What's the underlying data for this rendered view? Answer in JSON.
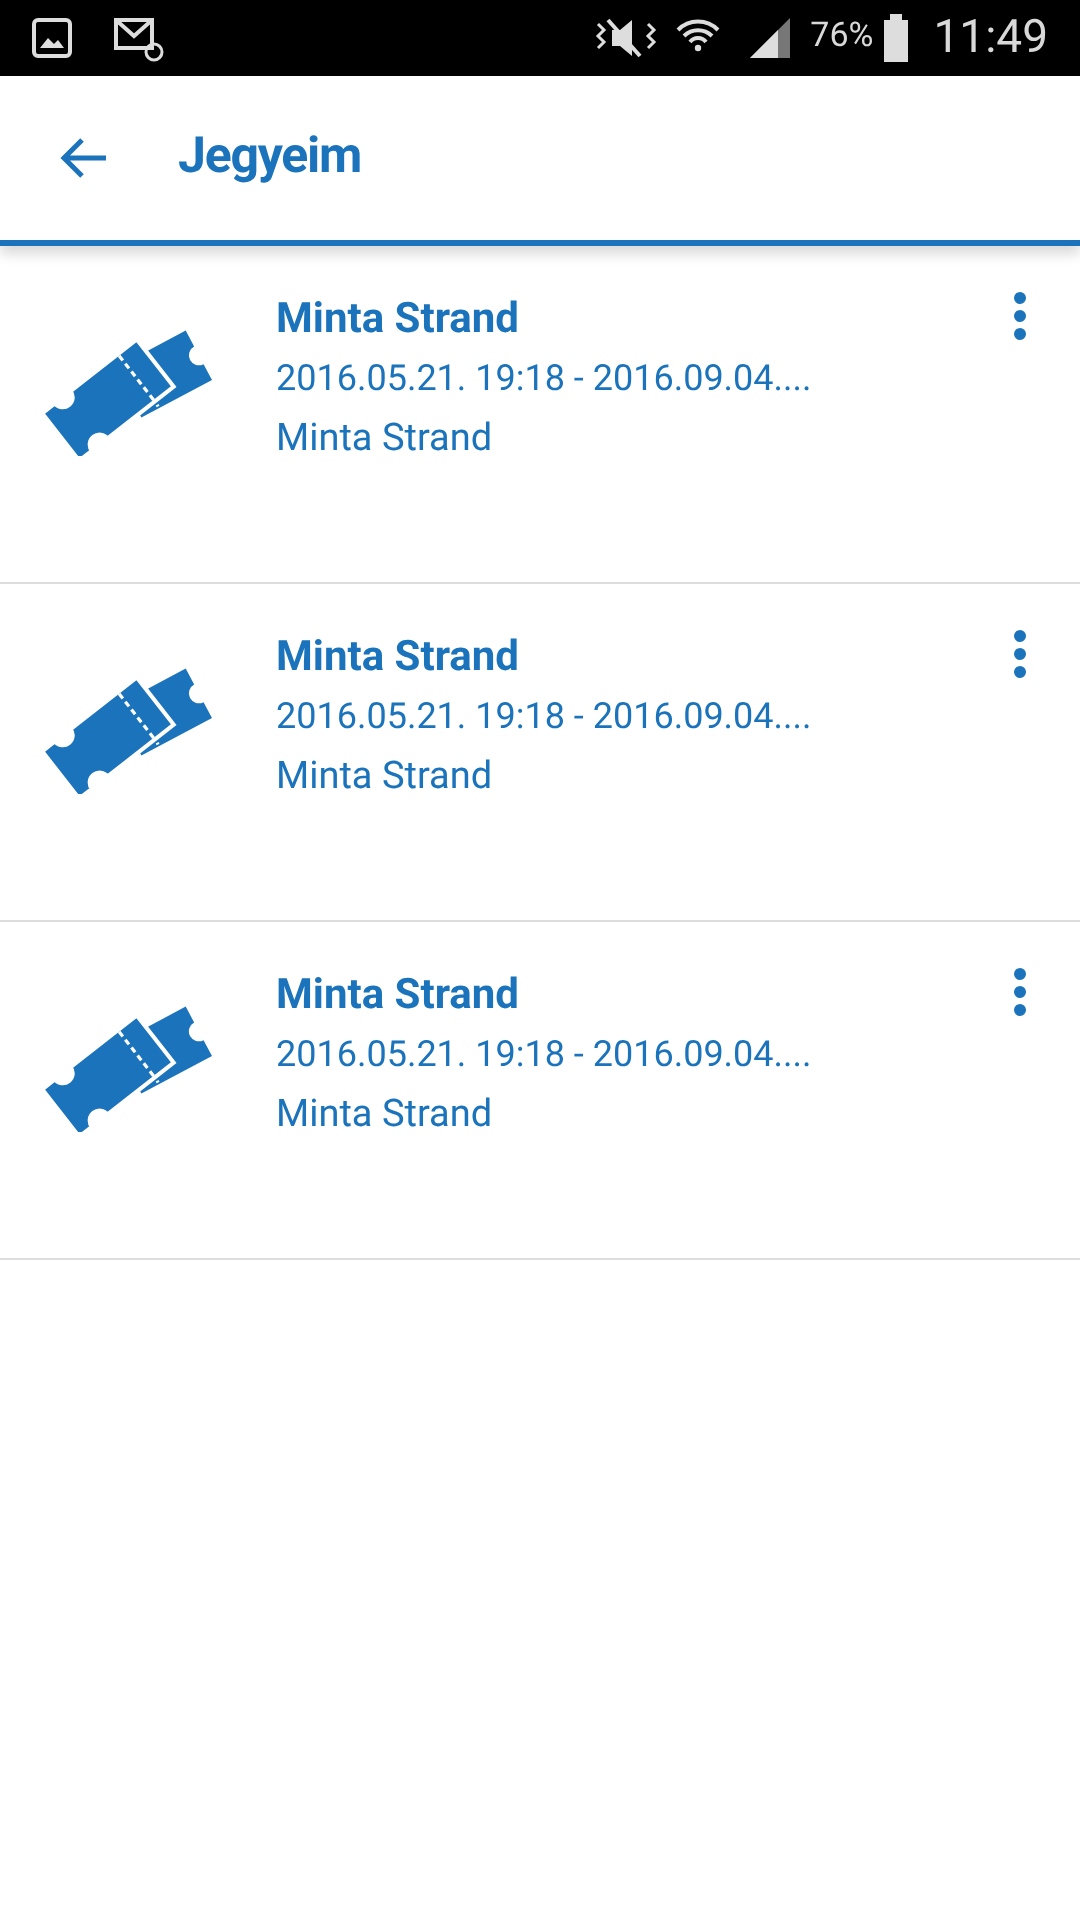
{
  "status_bar": {
    "battery": "76%",
    "time": "11:49"
  },
  "app_bar": {
    "title": "Jegyeim"
  },
  "tickets": [
    {
      "title": "Minta Strand",
      "dates": "2016.05.21. 19:18 - 2016.09.04....",
      "place": "Minta Strand"
    },
    {
      "title": "Minta Strand",
      "dates": "2016.05.21. 19:18 - 2016.09.04....",
      "place": "Minta Strand"
    },
    {
      "title": "Minta Strand",
      "dates": "2016.05.21. 19:18 - 2016.09.04....",
      "place": "Minta Strand"
    }
  ]
}
